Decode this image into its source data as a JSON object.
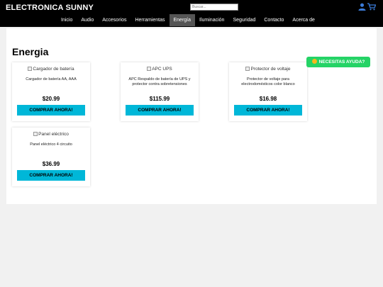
{
  "header": {
    "brand": "ELECTRONICA SUNNY",
    "search_placeholder": "Buscar...",
    "icons": [
      "user-icon",
      "cart-icon"
    ],
    "nav": [
      "Inicio",
      "Audio",
      "Accesorios",
      "Herramientas",
      "Energía",
      "Iluminación",
      "Seguridad",
      "Contacto",
      "Acerca de"
    ],
    "active_nav": "Energía"
  },
  "main": {
    "title": "Energia",
    "products": [
      {
        "img_alt": "Cargador de batería",
        "description": "Cargador de batería AA, AAA",
        "price": "$20.99",
        "button": "COMPRAR AHORA!"
      },
      {
        "img_alt": "APC UPS",
        "description": "APC Respaldo de batería de UPS y protector contra sobretensiones",
        "price": "$115.99",
        "button": "COMPRAR AHORA!"
      },
      {
        "img_alt": "Protector de voltaje",
        "description": "Protector de voltaje para electrodomésticos color blanco",
        "price": "$16.98",
        "button": "COMPRAR AHORA!"
      },
      {
        "img_alt": "Panel eléctrico",
        "description": "Panel eléctrico 4 circuito",
        "price": "$36.99",
        "button": "COMPRAR AHORA!"
      }
    ]
  },
  "help_button": {
    "label": "NECESITAS AYUDA?",
    "color": "#25d366"
  },
  "colors": {
    "topbar": "#000000",
    "accent": "#00b7d8",
    "active_nav": "#555555"
  }
}
